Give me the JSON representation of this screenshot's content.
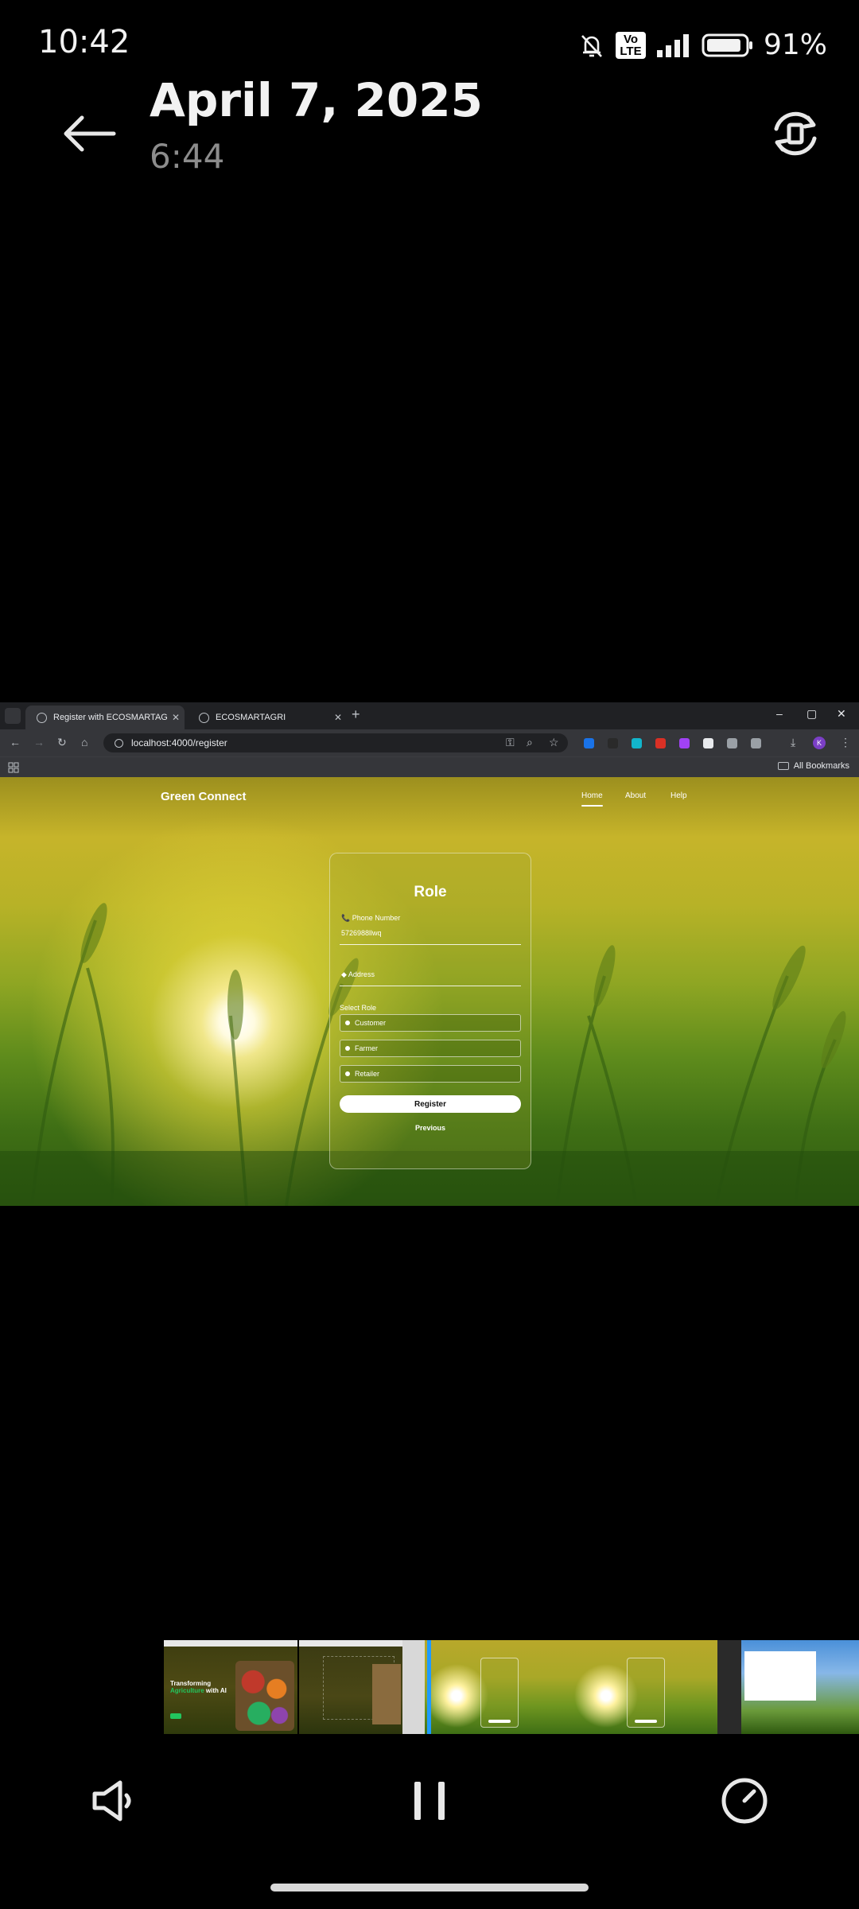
{
  "status_bar": {
    "time": "10:42",
    "volte_top": "Vo",
    "volte_bottom": "LTE",
    "battery_percent": "91%",
    "battery_level": 0.91
  },
  "header": {
    "date": "April 7, 2025",
    "time": "6:44",
    "back_icon": "arrow-left-icon",
    "rotate_icon": "rotate-screen-icon"
  },
  "browser": {
    "tabs": [
      {
        "label": "Register with ECOSMARTAGRI",
        "active": true
      },
      {
        "label": "ECOSMARTAGRI",
        "active": false
      }
    ],
    "url": "localhost:4000/register",
    "bookmarks_label": "All Bookmarks",
    "extension_colors": [
      "#1a73e8",
      "#2a2a2a",
      "#12b5cb",
      "#d93025",
      "#a142f4",
      "#e8eaed",
      "#9aa0a6",
      "#9aa0a6"
    ],
    "profile_initial": "K"
  },
  "site": {
    "brand": "Green Connect",
    "nav": {
      "home": "Home",
      "about": "About",
      "help": "Help"
    },
    "form": {
      "title": "Role",
      "phone_label": "📞 Phone Number",
      "phone_value": "5726988llwq",
      "address_label": "◆ Address",
      "select_role_label": "Select Role",
      "roles": [
        "Customer",
        "Farmer",
        "Retailer"
      ],
      "register_label": "Register",
      "previous_label": "Previous"
    }
  },
  "timeline": {
    "thumb1_headline_a": "Transforming",
    "thumb1_headline_b": "Agriculture",
    "thumb1_headline_c": "with AI"
  },
  "colors": {
    "accent_playhead": "#1e9bff",
    "brand_green": "#22c55e"
  }
}
